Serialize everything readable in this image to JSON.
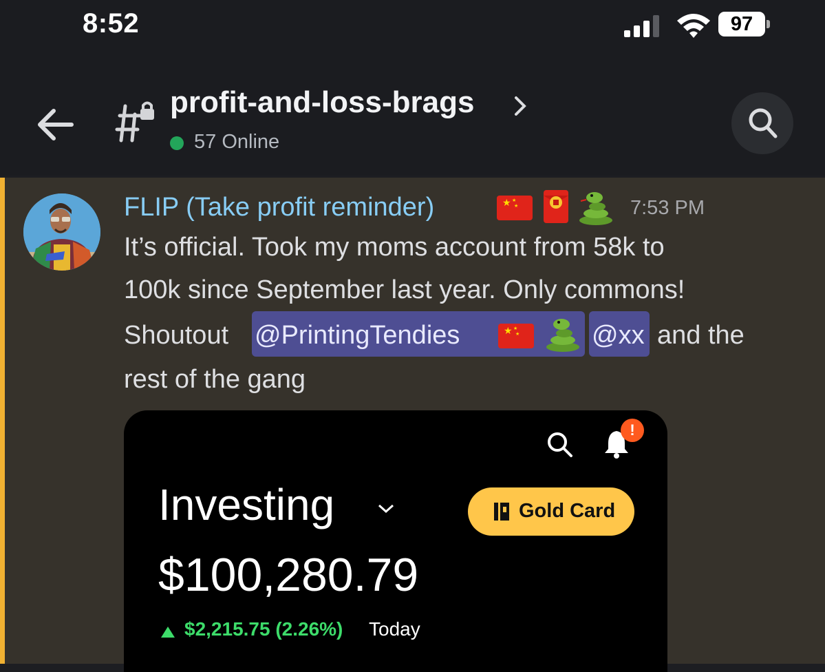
{
  "status_bar": {
    "time": "8:52",
    "battery": "97",
    "icons": [
      "signal-icon",
      "wifi-icon",
      "battery-icon"
    ]
  },
  "header": {
    "channel_name": "profit-and-loss-brags",
    "online": "57 Online",
    "icons": [
      "back-arrow-icon",
      "locked-channel-icon",
      "chevron-right-icon",
      "search-icon"
    ]
  },
  "message": {
    "username": "FLIP (Take profit reminder)",
    "timestamp": "7:53 PM",
    "lines": [
      "It’s official. Took my moms account from 58k to",
      "100k since September last year. Only commons!",
      "Shoutout",
      "and the",
      "rest of the gang"
    ],
    "mentions": [
      "@PrintingTendies",
      "@xx"
    ],
    "emoji": [
      "china-flag-emoji",
      "red-envelope-emoji",
      "snake-emoji"
    ],
    "colors": {
      "username": "#88cdf5",
      "mention_bg": "#4e4e93",
      "mention_bar": "#f0b132",
      "online": "#23a55a"
    }
  },
  "embed": {
    "title": "Investing",
    "gold_card": "Gold Card",
    "balance": "$100,280.79",
    "change": "$2,215.75 (2.26%)",
    "change_period": "Today",
    "alert_badge": "!",
    "colors": {
      "gold": "#ffc64a",
      "gain": "#3ddc6a",
      "alert": "#ff5a1f"
    }
  }
}
